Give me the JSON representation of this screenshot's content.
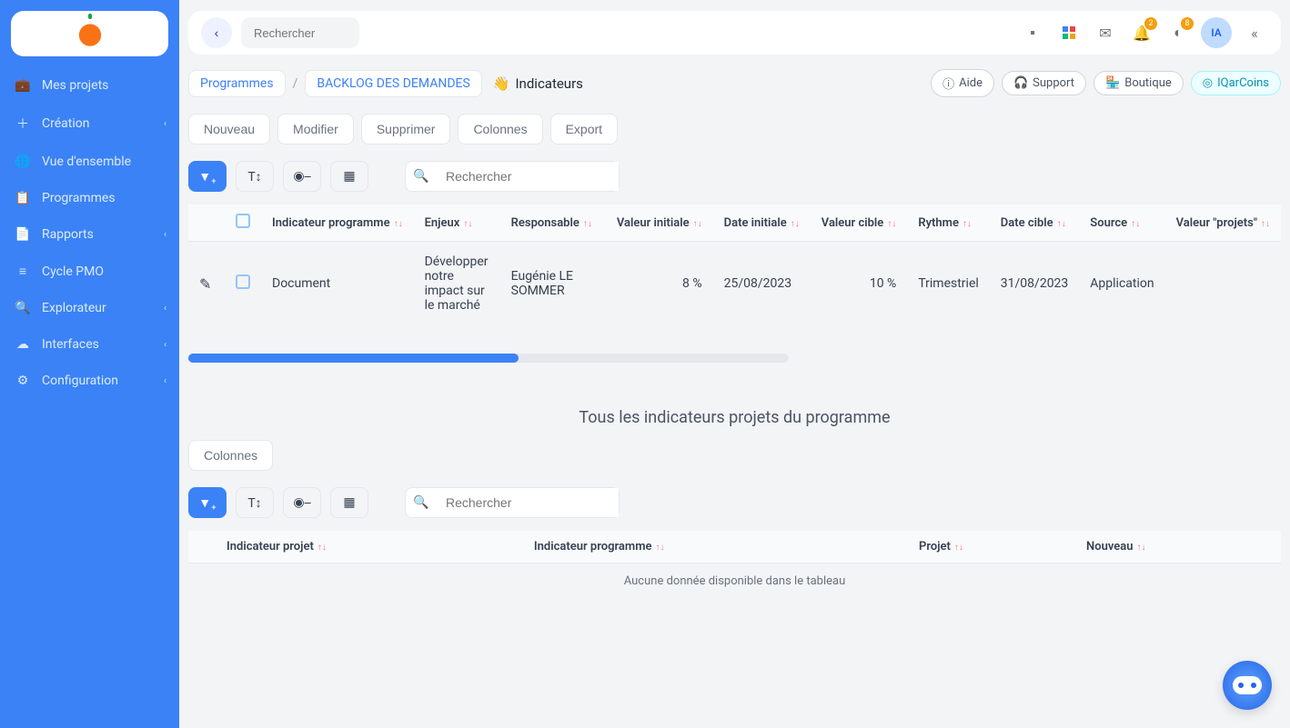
{
  "topbar": {
    "search_placeholder": "Rechercher",
    "bell_badge": "2",
    "moon_badge": "8",
    "avatar_initials": "IA"
  },
  "sidebar": {
    "items": [
      {
        "icon": "💼",
        "label": "Mes projets",
        "expandable": false
      },
      {
        "icon": "＋",
        "label": "Création",
        "expandable": true
      },
      {
        "icon": "🌐",
        "label": "Vue d'ensemble",
        "expandable": false
      },
      {
        "icon": "📋",
        "label": "Programmes",
        "expandable": false
      },
      {
        "icon": "📄",
        "label": "Rapports",
        "expandable": true
      },
      {
        "icon": "≡",
        "label": "Cycle PMO",
        "expandable": false
      },
      {
        "icon": "🔍",
        "label": "Explorateur",
        "expandable": true
      },
      {
        "icon": "☁",
        "label": "Interfaces",
        "expandable": true
      },
      {
        "icon": "⚙",
        "label": "Configuration",
        "expandable": true
      }
    ]
  },
  "breadcrumb": {
    "level1": "Programmes",
    "sep": "/",
    "level2": "BACKLOG DES DEMANDES",
    "current_emoji": "👋",
    "current": "Indicateurs"
  },
  "help_pills": {
    "aide": "Aide",
    "support": "Support",
    "boutique": "Boutique",
    "iqarcoins": "IQarCoins"
  },
  "actions": {
    "nouveau": "Nouveau",
    "modifier": "Modifier",
    "supprimer": "Supprimer",
    "colonnes": "Colonnes",
    "export": "Export"
  },
  "toolbar": {
    "search_placeholder": "Rechercher"
  },
  "table1": {
    "headers": {
      "indicateur_programme": "Indicateur programme",
      "enjeux": "Enjeux",
      "responsable": "Responsable",
      "valeur_initiale": "Valeur initiale",
      "date_initiale": "Date initiale",
      "valeur_cible": "Valeur cible",
      "rythme": "Rythme",
      "date_cible": "Date cible",
      "source": "Source",
      "valeur_projets": "Valeur \"projets\""
    },
    "rows": [
      {
        "indicateur_programme": "Document",
        "enjeux": "Développer notre impact sur le marché",
        "responsable": "Eugénie LE SOMMER",
        "valeur_initiale": "8 %",
        "date_initiale": "25/08/2023",
        "valeur_cible": "10 %",
        "rythme": "Trimestriel",
        "date_cible": "31/08/2023",
        "source": "Application",
        "valeur_projets": ""
      }
    ]
  },
  "section2": {
    "title": "Tous les indicateurs projets du programme",
    "colonnes": "Colonnes"
  },
  "table2": {
    "headers": {
      "indicateur_projet": "Indicateur projet",
      "indicateur_programme": "Indicateur programme",
      "projet": "Projet",
      "nouveau": "Nouveau"
    },
    "empty": "Aucune donnée disponible dans le tableau"
  }
}
